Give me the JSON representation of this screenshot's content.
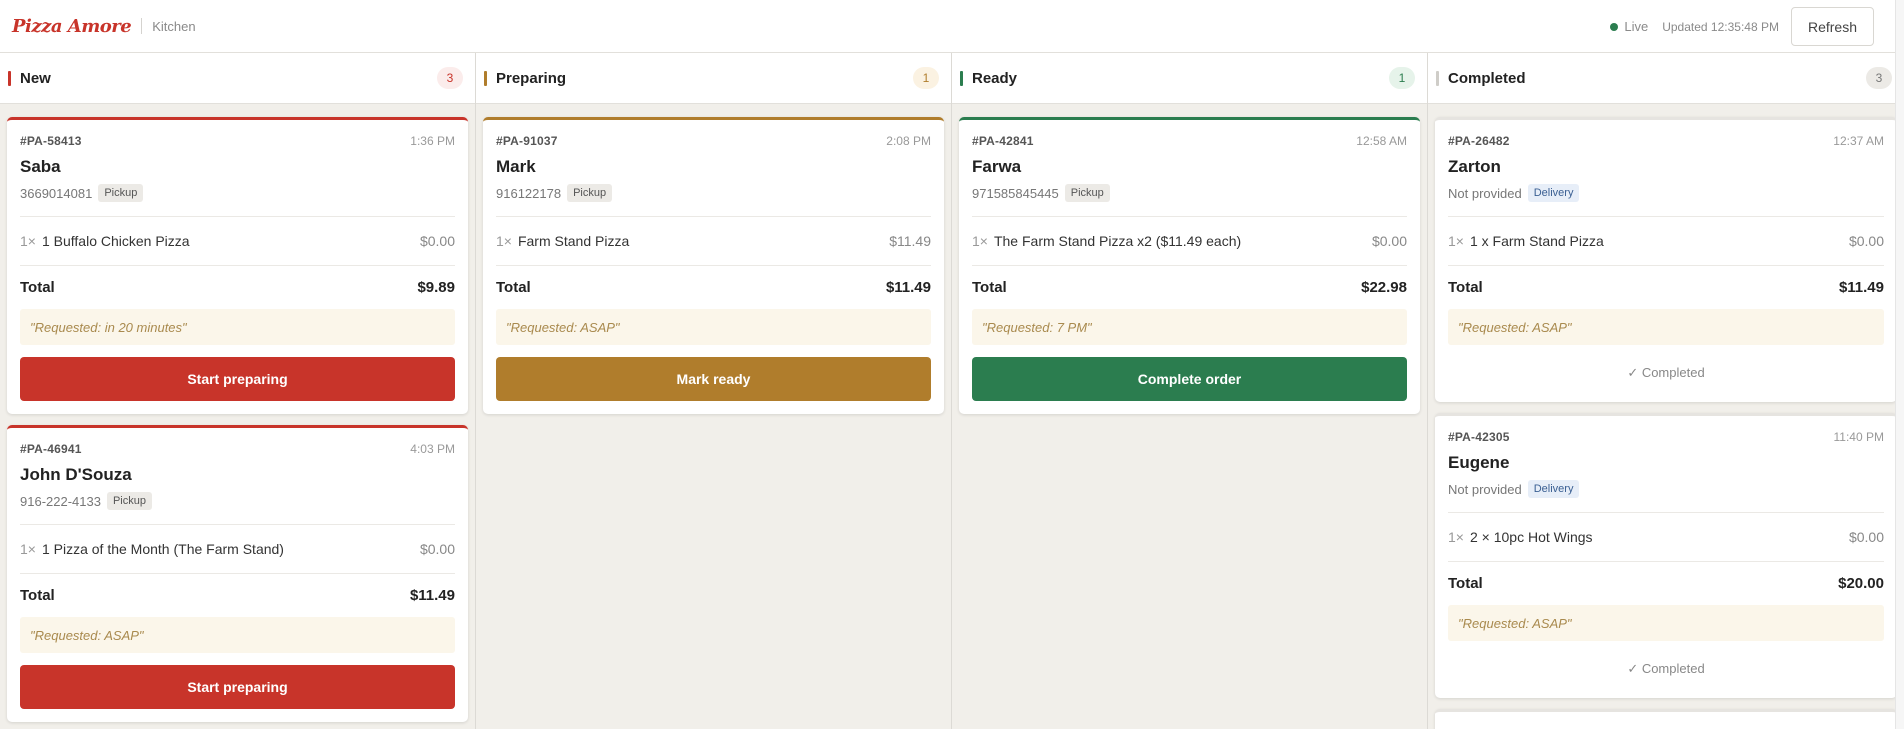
{
  "header": {
    "brand": "Pizza Amore",
    "section": "Kitchen",
    "live_label": "Live",
    "updated": "Updated 12:35:48 PM",
    "refresh_label": "Refresh"
  },
  "colors": {
    "accent_red": "#c8342a",
    "preparing": "#b07d2c",
    "ready": "#2b7d4f",
    "completed": "#cfcdc8"
  },
  "columns": [
    {
      "title": "New",
      "count": "3",
      "orders": [
        {
          "id": "#PA-58413",
          "time": "1:36 PM",
          "name": "Saba",
          "phone": "3669014081",
          "type": "Pickup",
          "qty": "1×",
          "item": "1 Buffalo Chicken Pizza",
          "price": "$0.00",
          "total_label": "Total",
          "total": "$9.89",
          "note": "\"Requested: in 20 minutes\"",
          "action": "Start preparing"
        },
        {
          "id": "#PA-46941",
          "time": "4:03 PM",
          "name": "John D'Souza",
          "phone": "916-222-4133",
          "type": "Pickup",
          "qty": "1×",
          "item": "1 Pizza of the Month (The Farm Stand)",
          "price": "$0.00",
          "total_label": "Total",
          "total": "$11.49",
          "note": "\"Requested: ASAP\"",
          "action": "Start preparing"
        }
      ]
    },
    {
      "title": "Preparing",
      "count": "1",
      "orders": [
        {
          "id": "#PA-91037",
          "time": "2:08 PM",
          "name": "Mark",
          "phone": "916122178",
          "type": "Pickup",
          "qty": "1×",
          "item": "Farm Stand Pizza",
          "price": "$11.49",
          "total_label": "Total",
          "total": "$11.49",
          "note": "\"Requested: ASAP\"",
          "action": "Mark ready"
        }
      ]
    },
    {
      "title": "Ready",
      "count": "1",
      "orders": [
        {
          "id": "#PA-42841",
          "time": "12:58 AM",
          "name": "Farwa",
          "phone": "971585845445",
          "type": "Pickup",
          "qty": "1×",
          "item": "The Farm Stand Pizza x2 ($11.49 each)",
          "price": "$0.00",
          "total_label": "Total",
          "total": "$22.98",
          "note": "\"Requested: 7 PM\"",
          "action": "Complete order"
        }
      ]
    },
    {
      "title": "Completed",
      "count": "3",
      "orders": [
        {
          "id": "#PA-26482",
          "time": "12:37 AM",
          "name": "Zarton",
          "phone": "Not provided",
          "type": "Delivery",
          "qty": "1×",
          "item": "1 x Farm Stand Pizza",
          "price": "$0.00",
          "total_label": "Total",
          "total": "$11.49",
          "note": "\"Requested: ASAP\"",
          "status": "✓ Completed"
        },
        {
          "id": "#PA-42305",
          "time": "11:40 PM",
          "name": "Eugene",
          "phone": "Not provided",
          "type": "Delivery",
          "qty": "1×",
          "item": "2 × 10pc Hot Wings",
          "price": "$0.00",
          "total_label": "Total",
          "total": "$20.00",
          "note": "\"Requested: ASAP\"",
          "status": "✓ Completed"
        }
      ]
    }
  ]
}
